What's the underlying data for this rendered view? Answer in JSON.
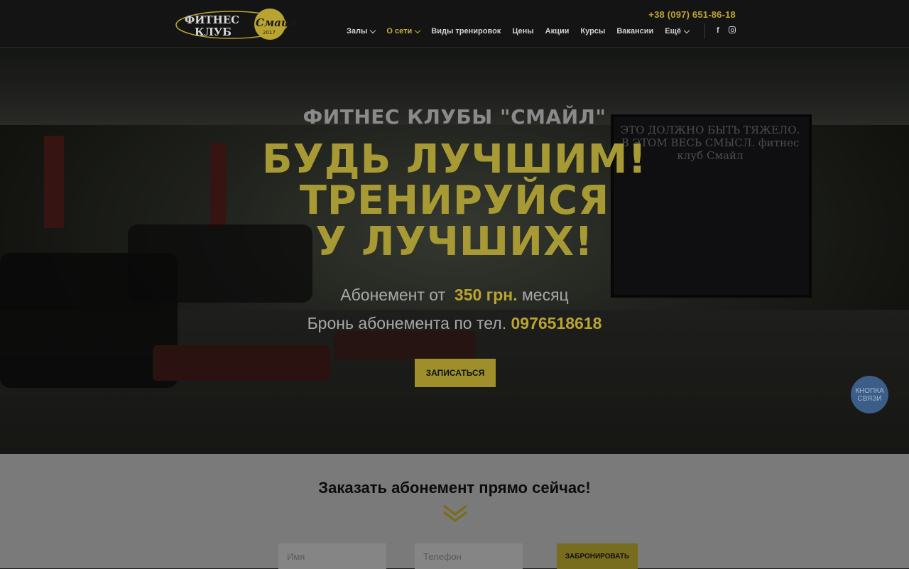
{
  "header": {
    "logo_text_line1": "ФИТНЕС",
    "logo_text_line2": "КЛУБ",
    "logo_script": "Смайл",
    "logo_year": "2017",
    "phone": "+38 (097) 651-86-18",
    "nav": [
      {
        "label": "Залы",
        "dropdown": true,
        "active": false
      },
      {
        "label": "О сети",
        "dropdown": true,
        "active": true
      },
      {
        "label": "Виды тренировок",
        "dropdown": false,
        "active": false
      },
      {
        "label": "Цены",
        "dropdown": false,
        "active": false
      },
      {
        "label": "Акции",
        "dropdown": false,
        "active": false
      },
      {
        "label": "Курсы",
        "dropdown": false,
        "active": false
      },
      {
        "label": "Вакансии",
        "dropdown": false,
        "active": false
      },
      {
        "label": "Ещё",
        "dropdown": true,
        "active": false
      }
    ],
    "social": {
      "facebook": "f",
      "instagram": "instagram-icon"
    }
  },
  "hero": {
    "subtitle": "ФИТНЕС КЛУБЫ \"СМАЙЛ\"",
    "title_line1": "БУДЬ ЛУЧШИМ!",
    "title_line2": "ТРЕНИРУЙСЯ",
    "title_line3": "У ЛУЧШИХ!",
    "price_prefix": "Абонемент от",
    "price_value": "350 грн.",
    "price_suffix": "месяц",
    "phone_prefix": "Бронь абонемента по тел.",
    "phone_value": "0976518618",
    "cta_label": "ЗАПИСАТЬСЯ",
    "poster_text": "ЭТО ДОЛЖНО БЫТЬ ТЯЖЕЛО. В ЭТОМ ВЕСЬ СМЫСЛ. фитнес клуб Смайл"
  },
  "contact_button": {
    "line1": "КНОПКА",
    "line2": "СВЯЗИ"
  },
  "order": {
    "title": "Заказать абонемент прямо сейчас!",
    "name_placeholder": "Имя",
    "phone_placeholder": "Телефон",
    "submit_label": "ЗАБРОНИРОВАТЬ"
  },
  "colors": {
    "accent": "#b9a432",
    "header_bg": "#141414",
    "order_bg": "#7a7a7a",
    "contact_button": "#3b5d88"
  }
}
